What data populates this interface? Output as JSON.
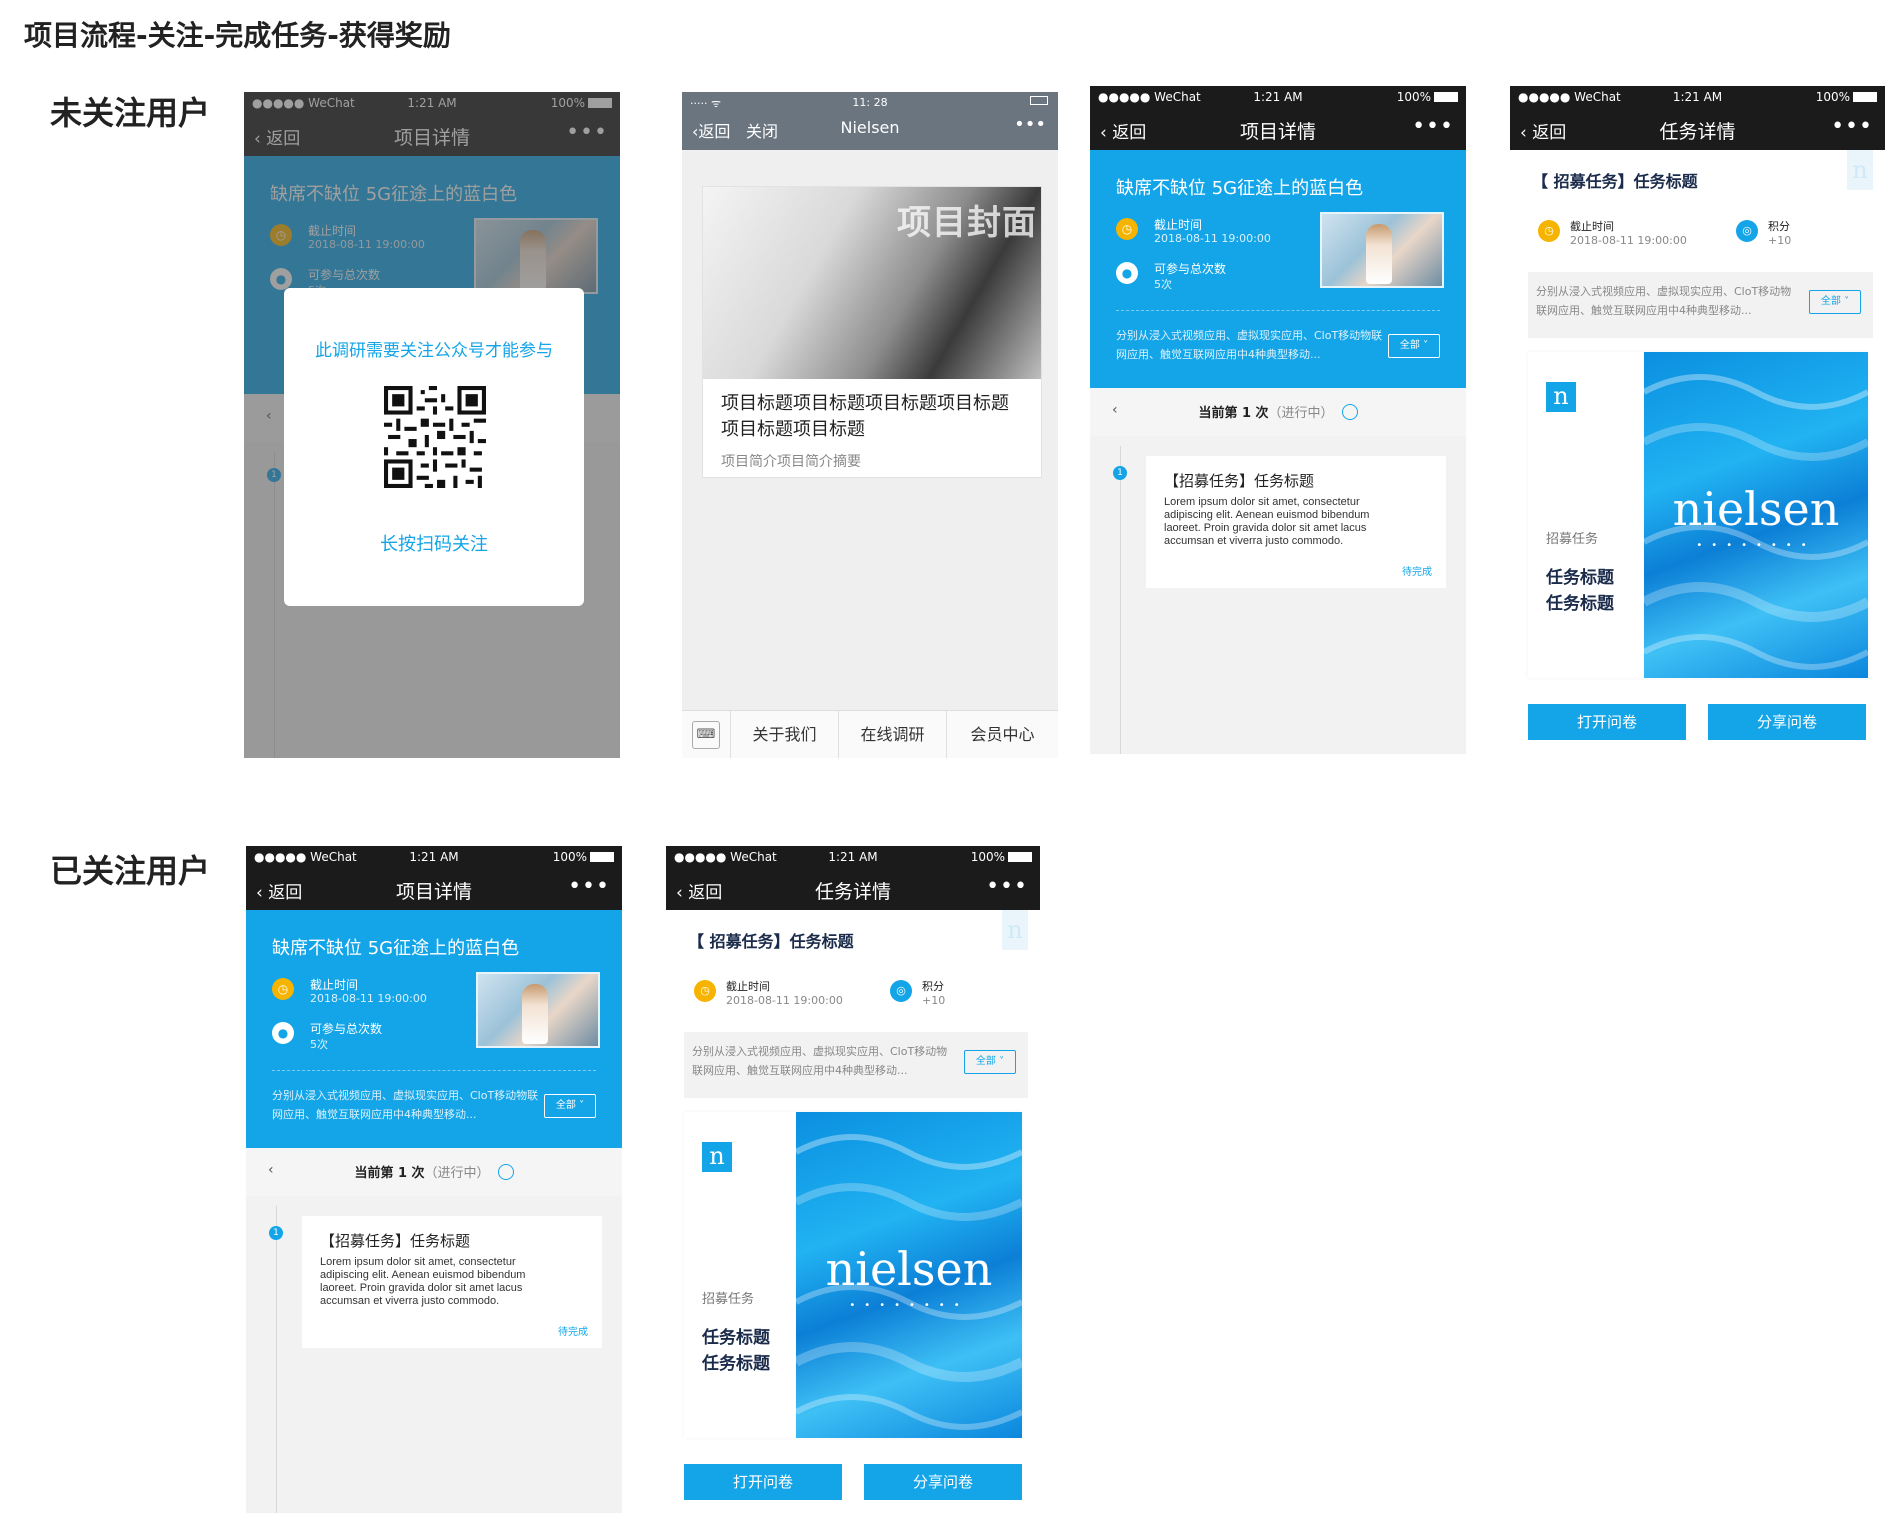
{
  "page_title": "项目流程-关注-完成任务-获得奖励",
  "rows": {
    "unfollowed_label": "未关注用户",
    "followed_label": "已关注用户"
  },
  "status": {
    "carrier": "●●●●● WeChat",
    "time": "1:21 AM",
    "battery": "100%",
    "article_time": "11: 28"
  },
  "nav": {
    "back": "返回",
    "close": "关闭",
    "more": "•••",
    "project_title": "项目详情",
    "task_title": "任务详情",
    "account_title": "Nielsen"
  },
  "project": {
    "title": "缺席不缺位 5G征途上的蓝白色",
    "deadline_label": "截止时间",
    "deadline_value": "2018-08-11 19:00:00",
    "count_label": "可参与总次数",
    "count_value": "5次",
    "desc": "分别从浸入式视频应用、虚拟现实应用、CloT移动物联网应用、触觉互联网应用中4种典型移动...",
    "all_button": "全部",
    "round_prev": "‹",
    "round_text": "当前第 1 次",
    "round_status": "（进行中）"
  },
  "task_card": {
    "title": "【招募任务】任务标题",
    "body": "Lorem ipsum dolor sit amet, consectetur adipiscing elit. Aenean euismod bibendum laoreet. Proin gravida dolor sit amet lacus accumsan et viverra justo commodo.",
    "status": "待完成",
    "index": "1"
  },
  "task_detail": {
    "title": "【 招募任务】任务标题",
    "deadline_label": "截止时间",
    "deadline_value": "2018-08-11 19:00:00",
    "points_label": "积分",
    "points_value": "+10",
    "desc": "分别从浸入式视频应用、虚拟现实应用、CloT移动物联网应用、触觉互联网应用中4种典型移动...",
    "all_button": "全部",
    "cover_logo": "n",
    "cover_sub": "招募任务",
    "cover_line1": "任务标题",
    "cover_line2": "任务标题",
    "brand": "nielsen",
    "brand_dots": "••••••••",
    "open_button": "打开问卷",
    "share_button": "分享问卷"
  },
  "modal": {
    "title": "此调研需要关注公众号才能参与",
    "hint": "长按扫码关注"
  },
  "article": {
    "cover_caption": "项目封面",
    "title": "项目标题项目标题项目标题项目标题项目标题项目标题",
    "summary": "项目简介项目简介摘要",
    "keyboard": "⌨",
    "menu": [
      "关于我们",
      "在线调研",
      "会员中心"
    ]
  },
  "colors": {
    "accent": "#13a5e8",
    "dark_bar": "#1b1b1b",
    "orange_icon": "#f6b400"
  }
}
